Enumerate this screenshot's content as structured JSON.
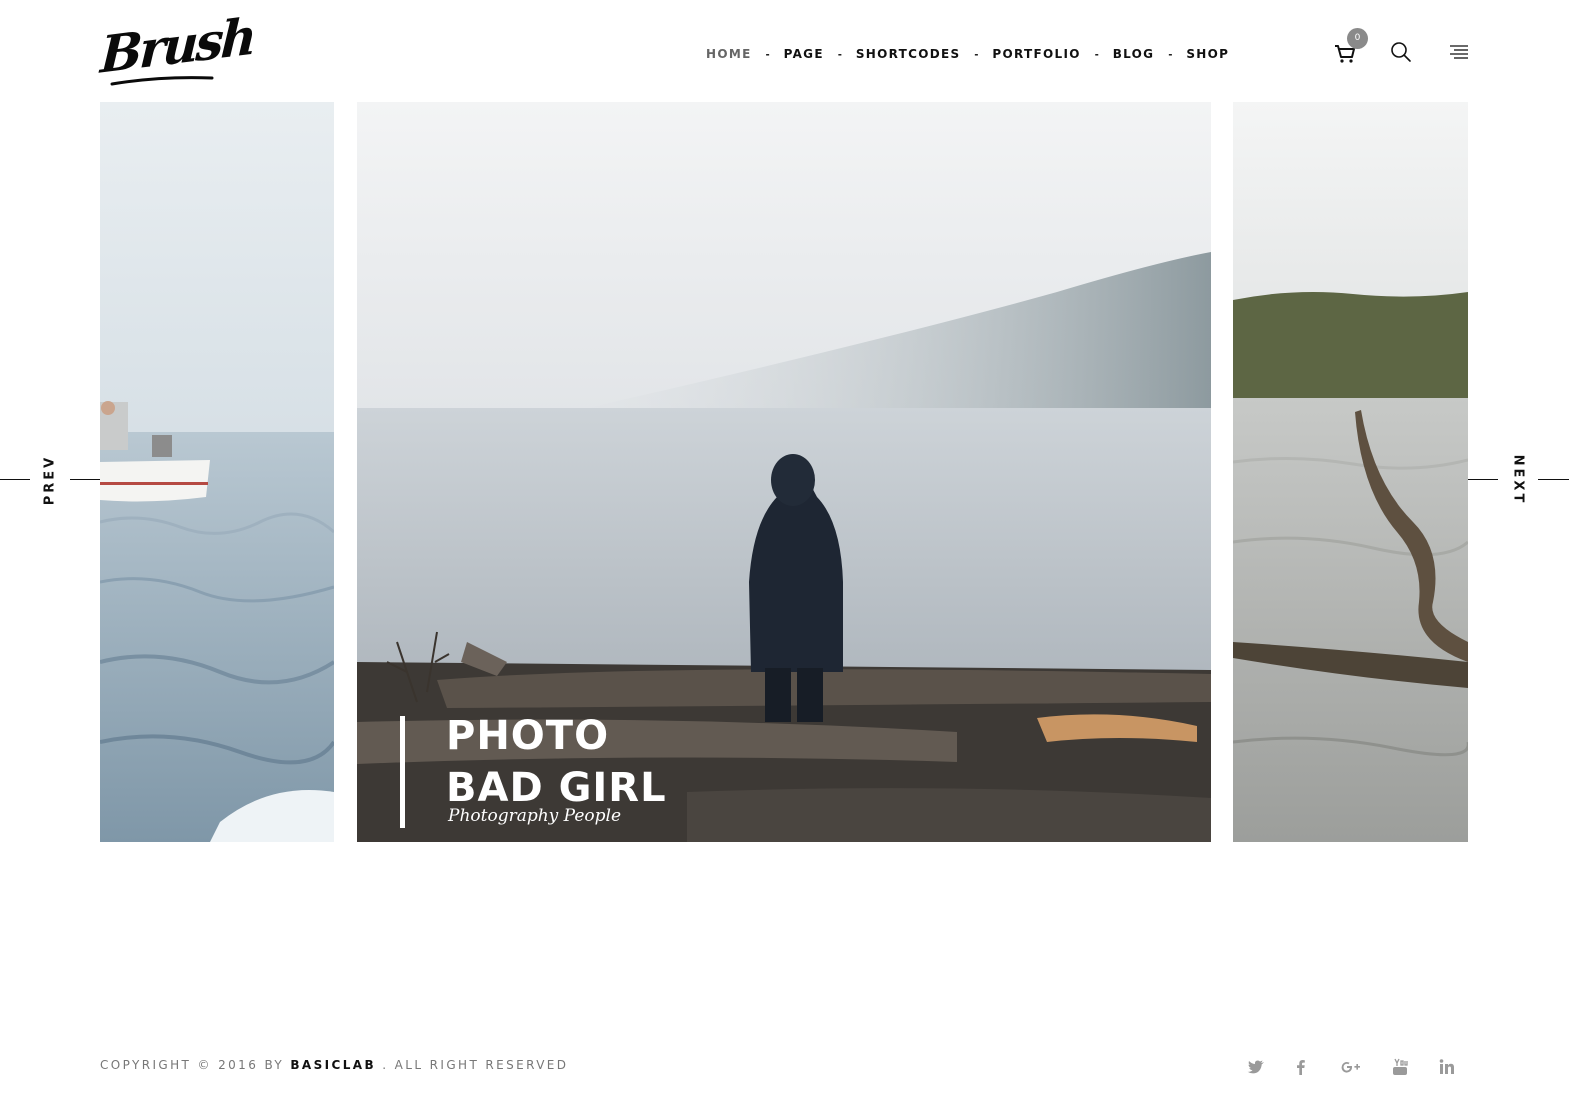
{
  "logo": {
    "text": "Brush"
  },
  "nav": {
    "items": [
      {
        "label": "HOME"
      },
      {
        "label": "PAGE"
      },
      {
        "label": "SHORTCODES"
      },
      {
        "label": "PORTFOLIO"
      },
      {
        "label": "BLOG"
      },
      {
        "label": "SHOP"
      }
    ],
    "separator": "-",
    "active_index": 0
  },
  "header_icons": {
    "cart_icon": "cart-icon",
    "cart_count": "0",
    "search_icon": "search-icon",
    "menu_icon": "hamburger-menu-icon"
  },
  "slider": {
    "prev_label": "PREV",
    "next_label": "NEXT",
    "current": {
      "title_line1": "PHOTO",
      "title_line2": "BAD GIRL",
      "subtitle": "Photography People"
    }
  },
  "footer": {
    "copyright_prefix": "COPYRIGHT © 2016 BY",
    "brand": "BASICLAB",
    "copyright_suffix": ". ALL RIGHT RESERVED",
    "social": [
      "twitter-icon",
      "facebook-icon",
      "google-plus-icon",
      "youtube-icon",
      "linkedin-icon"
    ]
  },
  "colors": {
    "text_dark": "#111111",
    "text_muted": "#777777",
    "icon_gray": "#9a9a9a",
    "badge_gray": "#8a8a8a",
    "background": "#ffffff"
  }
}
